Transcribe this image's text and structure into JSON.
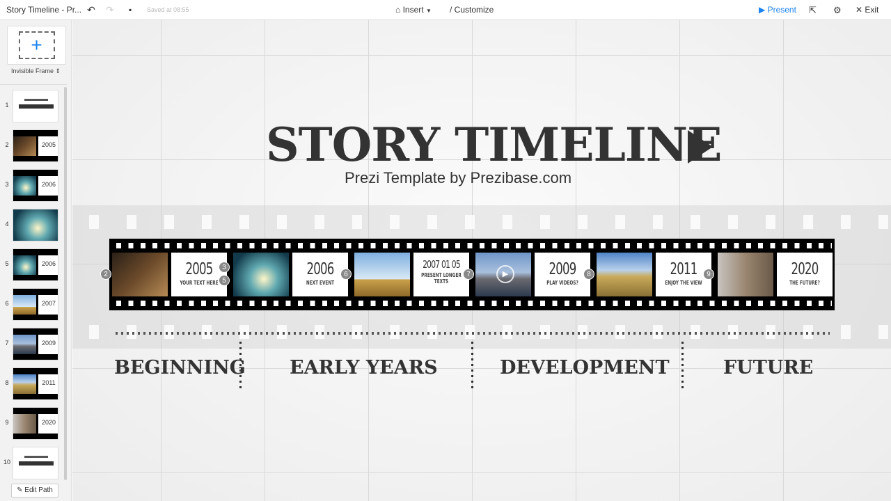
{
  "topbar": {
    "title": "Story Timeline - Pr...",
    "saved": "Saved at 08:55",
    "insert": "Insert",
    "customize": "Customize",
    "present": "Present",
    "exit": "Exit"
  },
  "sidebar": {
    "frame_type": "Invisible Frame",
    "edit_path": "Edit Path",
    "thumbnails": [
      "1",
      "2",
      "3",
      "4",
      "5",
      "6",
      "7",
      "8",
      "9",
      "10"
    ]
  },
  "canvas": {
    "title": "STORY TIMELINE",
    "subtitle": "Prezi Template by Prezibase.com",
    "frames": [
      {
        "year": "2005",
        "caption": "YOUR TEXT HERE",
        "photo": "laptop"
      },
      {
        "year": "2006",
        "caption": "NEXT EVENT",
        "photo": "skater"
      },
      {
        "year": "2007 01 05",
        "caption": "PRESENT LONGER TEXTS",
        "photo": "field-sky"
      },
      {
        "year": "2009",
        "caption": "PLAY VIDEOS?",
        "photo": "city-skyline"
      },
      {
        "year": "2011",
        "caption": "ENJOY THE VIEW",
        "photo": "feet-meadow"
      },
      {
        "year": "2020",
        "caption": "THE FUTURE?",
        "photo": "climber"
      }
    ],
    "badges": [
      "2",
      "3",
      "5",
      "6",
      "7",
      "8",
      "9"
    ],
    "sections": [
      "BEGINNING",
      "EARLY YEARS",
      "DEVELOPMENT",
      "FUTURE"
    ]
  },
  "colors": {
    "accent": "#1a82f0",
    "ink": "#333333"
  }
}
